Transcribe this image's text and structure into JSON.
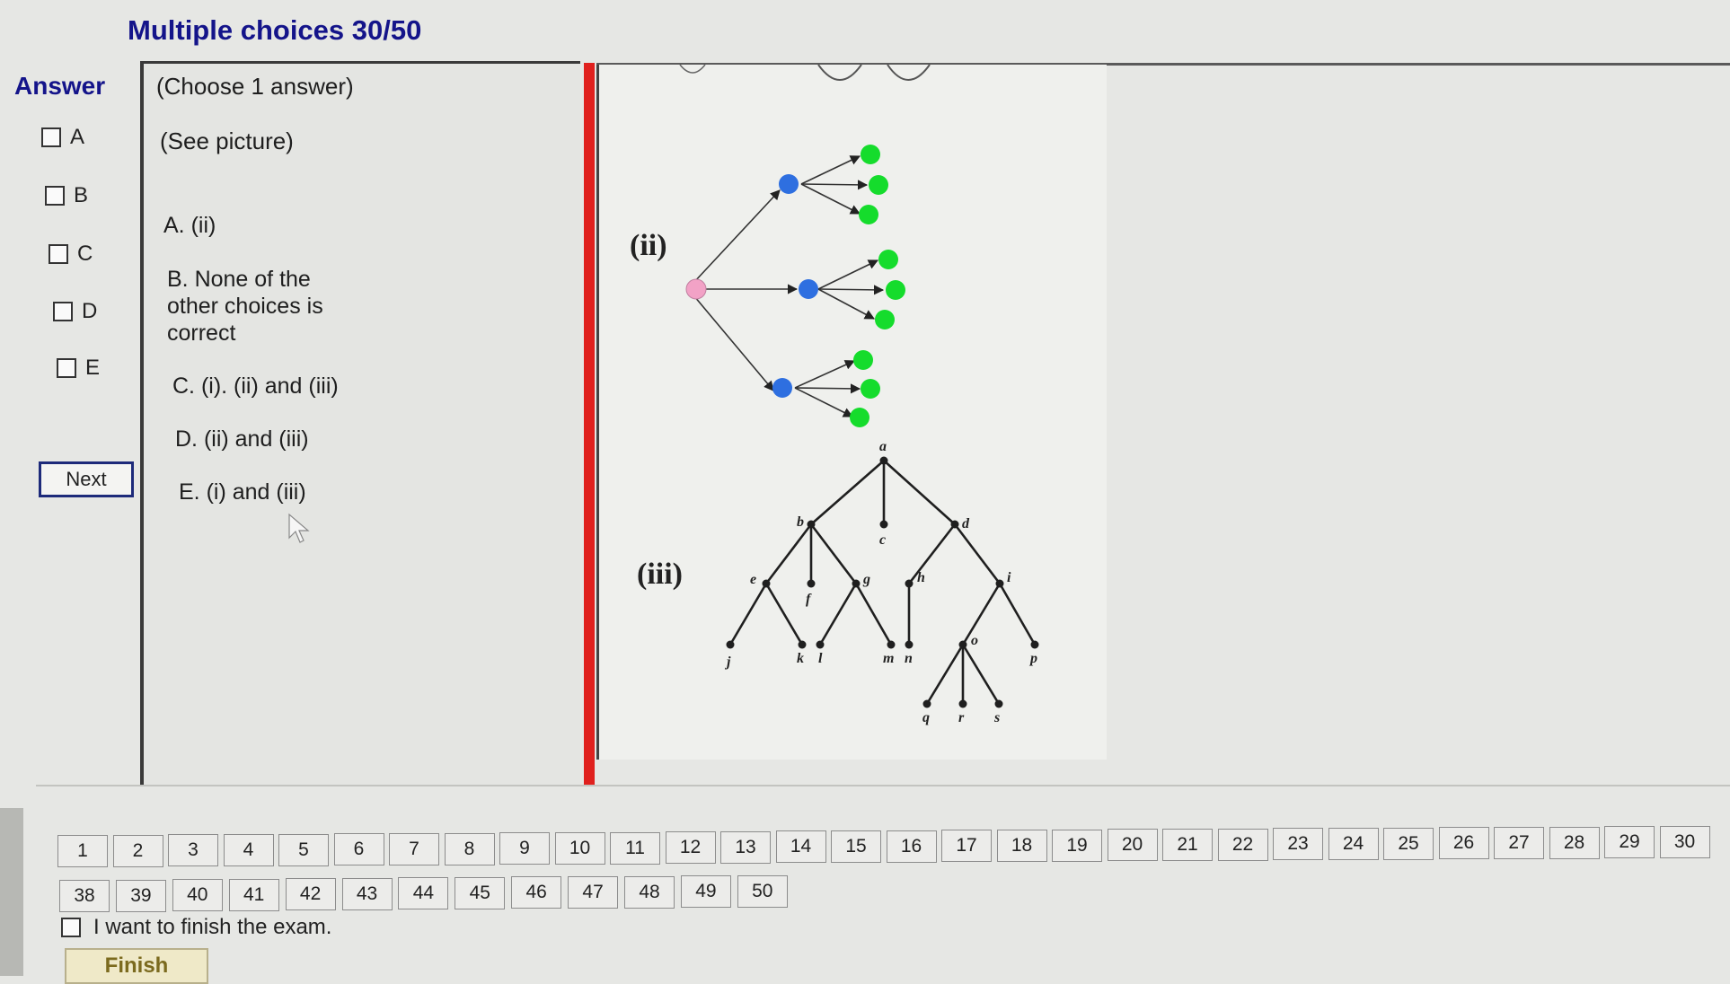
{
  "header": {
    "title": "Multiple choices 30/50"
  },
  "answer_panel": {
    "label": "Answer",
    "options": [
      "A",
      "B",
      "C",
      "D",
      "E"
    ],
    "next_label": "Next"
  },
  "question": {
    "instruction": "(Choose 1 answer)",
    "prompt": "(See picture)",
    "choices": [
      "A. (ii)",
      "B. None of the other choices is correct",
      "C. (i). (ii) and (iii)",
      "D. (ii) and (iii)",
      "E. (i) and (iii)"
    ]
  },
  "figure": {
    "label_ii": "(ii)",
    "label_iii": "(iii)",
    "tree_nodes": [
      "a",
      "b",
      "c",
      "d",
      "e",
      "f",
      "g",
      "h",
      "i",
      "j",
      "k",
      "l",
      "m",
      "n",
      "o",
      "p",
      "q",
      "r",
      "s"
    ],
    "colors": {
      "root": "#f2a2c6",
      "level1": "#2e6fe0",
      "leaf": "#15dc2c"
    }
  },
  "pagination": {
    "row1": [
      "1",
      "2",
      "3",
      "4",
      "5",
      "6",
      "7",
      "8",
      "9",
      "10",
      "11",
      "12",
      "13",
      "14",
      "15",
      "16",
      "17",
      "18",
      "19",
      "20",
      "21",
      "22",
      "23",
      "24",
      "25",
      "26",
      "27",
      "28",
      "29",
      "30"
    ],
    "row2": [
      "38",
      "39",
      "40",
      "41",
      "42",
      "43",
      "44",
      "45",
      "46",
      "47",
      "48",
      "49",
      "50"
    ]
  },
  "finish": {
    "checkbox_label": "I want to finish the exam.",
    "button_label": "Finish"
  }
}
